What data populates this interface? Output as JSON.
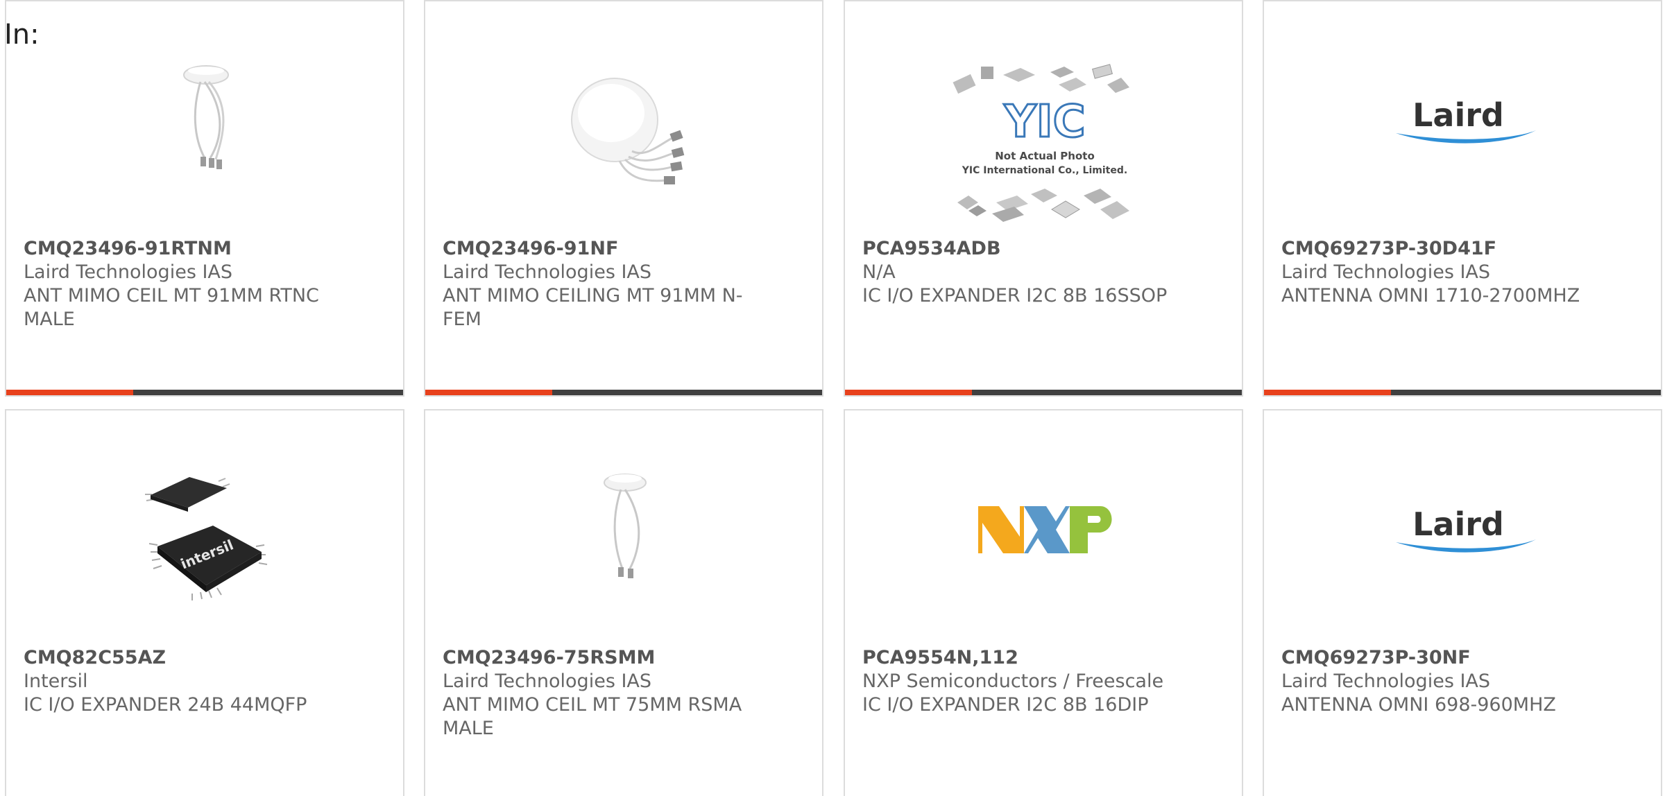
{
  "header": {
    "label": "In:"
  },
  "products": [
    {
      "part_number": "CMQ23496-91RTNM",
      "manufacturer": "Laird Technologies IAS",
      "description": "ANT MIMO CEIL MT 91MM RTNC MALE",
      "image": "ceiling-antenna-small",
      "progress": 0.32
    },
    {
      "part_number": "CMQ23496-91NF",
      "manufacturer": "Laird Technologies IAS",
      "description": "ANT MIMO CEILING MT 91MM N-FEM",
      "image": "ceiling-antenna-large",
      "progress": 0.32
    },
    {
      "part_number": "PCA9534ADB",
      "manufacturer": "N/A",
      "description": "IC I/O EXPANDER I2C 8B 16SSOP",
      "image": "yic-placeholder",
      "image_text": {
        "logo": "YIC",
        "line1": "Not Actual Photo",
        "line2": "YIC International Co., Limited."
      },
      "progress": 0.32
    },
    {
      "part_number": "CMQ69273P-30D41F",
      "manufacturer": "Laird Technologies IAS",
      "description": "ANTENNA OMNI 1710-2700MHZ",
      "image": "laird-logo",
      "image_text": {
        "logo": "Laird"
      },
      "progress": 0.32
    },
    {
      "part_number": "CMQ82C55AZ",
      "manufacturer": "Intersil",
      "description": "IC I/O EXPANDER 24B 44MQFP",
      "image": "qfp-chip",
      "image_text": {
        "logo": "intersil"
      }
    },
    {
      "part_number": "CMQ23496-75RSMM",
      "manufacturer": "Laird Technologies IAS",
      "description": "ANT MIMO CEIL MT 75MM RSMA MALE",
      "image": "ceiling-antenna-small"
    },
    {
      "part_number": "PCA9554N,112",
      "manufacturer": "NXP Semiconductors / Freescale",
      "description": "IC I/O EXPANDER I2C 8B 16DIP",
      "image": "nxp-logo",
      "image_text": {
        "logo": "NXP"
      }
    },
    {
      "part_number": "CMQ69273P-30NF",
      "manufacturer": "Laird Technologies IAS",
      "description": "ANTENNA OMNI 698-960MHZ",
      "image": "laird-logo",
      "image_text": {
        "logo": "Laird"
      }
    }
  ],
  "colors": {
    "accent": "#e8411c",
    "bar": "#404040",
    "border": "#dcdcdc",
    "text": "#666666"
  }
}
